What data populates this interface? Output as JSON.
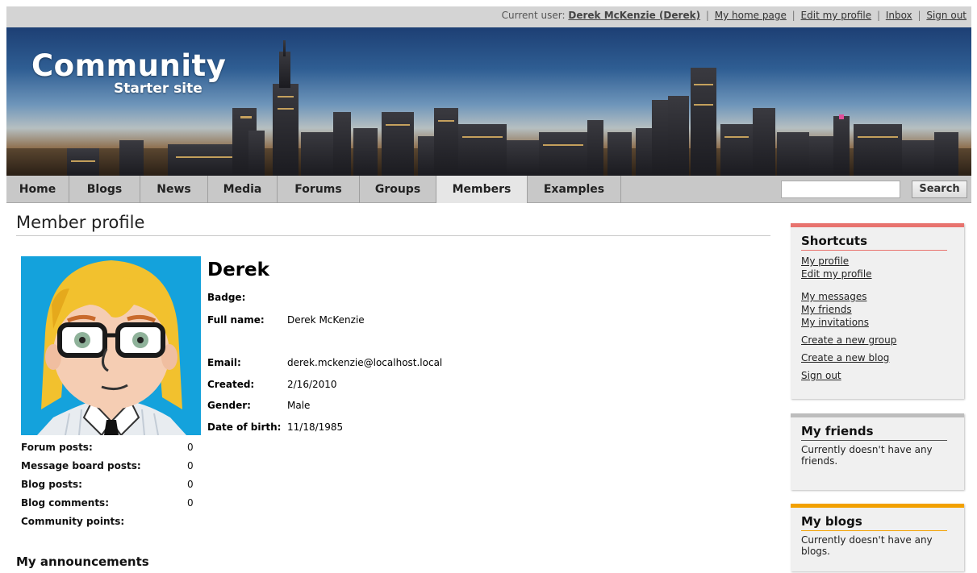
{
  "topbar": {
    "current_user_label": "Current user:",
    "user_name": "Derek McKenzie (Derek)",
    "links": [
      "My home page",
      "Edit my profile",
      "Inbox",
      "Sign out"
    ]
  },
  "logo": {
    "main": "Community",
    "sub": "Starter site"
  },
  "nav": {
    "items": [
      "Home",
      "Blogs",
      "News",
      "Media",
      "Forums",
      "Groups",
      "Members",
      "Examples"
    ],
    "active": "Members",
    "search_value": "",
    "search_button": "Search"
  },
  "page_title": "Member profile",
  "profile": {
    "name": "Derek",
    "fields": [
      {
        "label": "Badge:",
        "value": ""
      },
      {
        "label": "Full name:",
        "value": "Derek McKenzie"
      },
      {
        "label": "Email:",
        "value": "derek.mckenzie@localhost.local"
      },
      {
        "label": "Created:",
        "value": "2/16/2010"
      },
      {
        "label": "Gender:",
        "value": "Male"
      },
      {
        "label": "Date of birth:",
        "value": "11/18/1985"
      }
    ],
    "stats": [
      {
        "label": "Forum posts:",
        "value": "0"
      },
      {
        "label": "Message board posts:",
        "value": "0"
      },
      {
        "label": "Blog posts:",
        "value": "0"
      },
      {
        "label": "Blog comments:",
        "value": "0"
      },
      {
        "label": "Community points:",
        "value": ""
      }
    ],
    "announcements_title": "My announcements"
  },
  "sidebar": {
    "shortcuts": {
      "title": "Shortcuts",
      "accent": "#e8736e",
      "links": [
        "My profile",
        "Edit my profile",
        "My messages",
        "My friends",
        "My invitations",
        "Create a new group",
        "Create a new blog",
        "Sign out"
      ]
    },
    "friends": {
      "title": "My friends",
      "accent": "#bdbdbd",
      "text": "Currently doesn't have any friends."
    },
    "blogs": {
      "title": "My blogs",
      "accent": "#f2a100",
      "text": "Currently doesn't have any blogs."
    }
  }
}
